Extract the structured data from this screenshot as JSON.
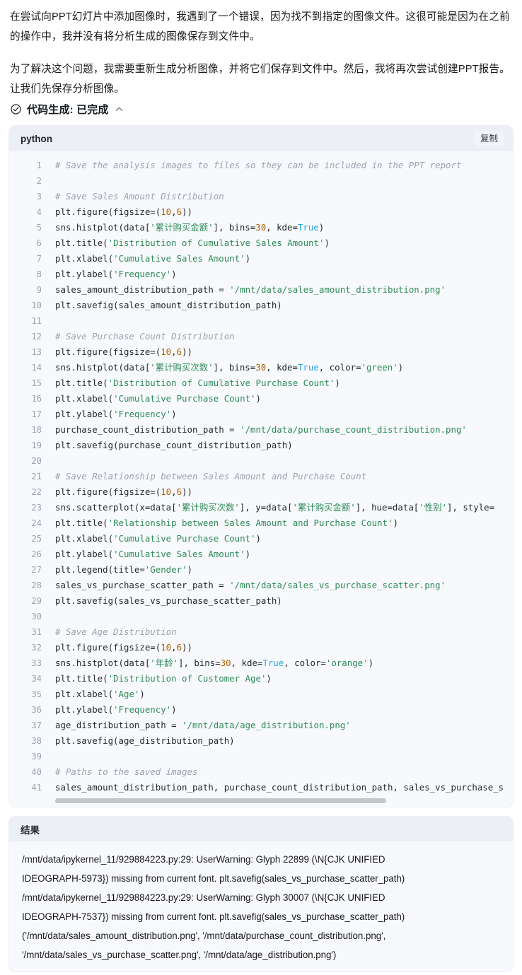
{
  "prose": {
    "paragraph_1": "在尝试向PPT幻灯片中添加图像时，我遇到了一个错误，因为找不到指定的图像文件。这很可能是因为在之前的操作中，我并没有将分析生成的图像保存到文件中。",
    "paragraph_2": "为了解决这个问题，我需要重新生成分析图像，并将它们保存到文件中。然后，我将再次尝试创建PPT报告。让我们先保存分析图像。"
  },
  "status": {
    "label": "代码生成: 已完成",
    "icon": "check-circle-icon",
    "toggle_icon": "chevron-up-icon",
    "accent_color": "#161b22"
  },
  "code_block": {
    "language": "python",
    "copy_label": "复制",
    "header_bg": "#eceff5",
    "body_bg": "#f7f9fc",
    "lines": [
      {
        "n": "1",
        "tokens": [
          {
            "t": "# Save the analysis images to files so they can be included in the PPT report",
            "c": "com"
          }
        ]
      },
      {
        "n": "2",
        "tokens": []
      },
      {
        "n": "3",
        "tokens": [
          {
            "t": "# Save Sales Amount Distribution",
            "c": "com"
          }
        ]
      },
      {
        "n": "4",
        "tokens": [
          {
            "t": "plt.figure(figsize=(",
            "c": "pln"
          },
          {
            "t": "10",
            "c": "num"
          },
          {
            "t": ",",
            "c": "pln"
          },
          {
            "t": "6",
            "c": "num"
          },
          {
            "t": "))",
            "c": "pln"
          }
        ]
      },
      {
        "n": "5",
        "tokens": [
          {
            "t": "sns.histplot(data[",
            "c": "pln"
          },
          {
            "t": "'累计购买金额'",
            "c": "str"
          },
          {
            "t": "], bins=",
            "c": "pln"
          },
          {
            "t": "30",
            "c": "num"
          },
          {
            "t": ", kde=",
            "c": "pln"
          },
          {
            "t": "True",
            "c": "kw"
          },
          {
            "t": ")",
            "c": "pln"
          }
        ]
      },
      {
        "n": "6",
        "tokens": [
          {
            "t": "plt.title(",
            "c": "pln"
          },
          {
            "t": "'Distribution of Cumulative Sales Amount'",
            "c": "str"
          },
          {
            "t": ")",
            "c": "pln"
          }
        ]
      },
      {
        "n": "7",
        "tokens": [
          {
            "t": "plt.xlabel(",
            "c": "pln"
          },
          {
            "t": "'Cumulative Sales Amount'",
            "c": "str"
          },
          {
            "t": ")",
            "c": "pln"
          }
        ]
      },
      {
        "n": "8",
        "tokens": [
          {
            "t": "plt.ylabel(",
            "c": "pln"
          },
          {
            "t": "'Frequency'",
            "c": "str"
          },
          {
            "t": ")",
            "c": "pln"
          }
        ]
      },
      {
        "n": "9",
        "tokens": [
          {
            "t": "sales_amount_distribution_path = ",
            "c": "pln"
          },
          {
            "t": "'/mnt/data/sales_amount_distribution.png'",
            "c": "str"
          }
        ]
      },
      {
        "n": "10",
        "tokens": [
          {
            "t": "plt.savefig(sales_amount_distribution_path)",
            "c": "pln"
          }
        ]
      },
      {
        "n": "11",
        "tokens": []
      },
      {
        "n": "12",
        "tokens": [
          {
            "t": "# Save Purchase Count Distribution",
            "c": "com"
          }
        ]
      },
      {
        "n": "13",
        "tokens": [
          {
            "t": "plt.figure(figsize=(",
            "c": "pln"
          },
          {
            "t": "10",
            "c": "num"
          },
          {
            "t": ",",
            "c": "pln"
          },
          {
            "t": "6",
            "c": "num"
          },
          {
            "t": "))",
            "c": "pln"
          }
        ]
      },
      {
        "n": "14",
        "tokens": [
          {
            "t": "sns.histplot(data[",
            "c": "pln"
          },
          {
            "t": "'累计购买次数'",
            "c": "str"
          },
          {
            "t": "], bins=",
            "c": "pln"
          },
          {
            "t": "30",
            "c": "num"
          },
          {
            "t": ", kde=",
            "c": "pln"
          },
          {
            "t": "True",
            "c": "kw"
          },
          {
            "t": ", color=",
            "c": "pln"
          },
          {
            "t": "'green'",
            "c": "str"
          },
          {
            "t": ")",
            "c": "pln"
          }
        ]
      },
      {
        "n": "15",
        "tokens": [
          {
            "t": "plt.title(",
            "c": "pln"
          },
          {
            "t": "'Distribution of Cumulative Purchase Count'",
            "c": "str"
          },
          {
            "t": ")",
            "c": "pln"
          }
        ]
      },
      {
        "n": "16",
        "tokens": [
          {
            "t": "plt.xlabel(",
            "c": "pln"
          },
          {
            "t": "'Cumulative Purchase Count'",
            "c": "str"
          },
          {
            "t": ")",
            "c": "pln"
          }
        ]
      },
      {
        "n": "17",
        "tokens": [
          {
            "t": "plt.ylabel(",
            "c": "pln"
          },
          {
            "t": "'Frequency'",
            "c": "str"
          },
          {
            "t": ")",
            "c": "pln"
          }
        ]
      },
      {
        "n": "18",
        "tokens": [
          {
            "t": "purchase_count_distribution_path = ",
            "c": "pln"
          },
          {
            "t": "'/mnt/data/purchase_count_distribution.png'",
            "c": "str"
          }
        ]
      },
      {
        "n": "19",
        "tokens": [
          {
            "t": "plt.savefig(purchase_count_distribution_path)",
            "c": "pln"
          }
        ]
      },
      {
        "n": "20",
        "tokens": []
      },
      {
        "n": "21",
        "tokens": [
          {
            "t": "# Save Relationship between Sales Amount and Purchase Count",
            "c": "com"
          }
        ]
      },
      {
        "n": "22",
        "tokens": [
          {
            "t": "plt.figure(figsize=(",
            "c": "pln"
          },
          {
            "t": "10",
            "c": "num"
          },
          {
            "t": ",",
            "c": "pln"
          },
          {
            "t": "6",
            "c": "num"
          },
          {
            "t": "))",
            "c": "pln"
          }
        ]
      },
      {
        "n": "23",
        "tokens": [
          {
            "t": "sns.scatterplot(x=data[",
            "c": "pln"
          },
          {
            "t": "'累计购买次数'",
            "c": "str"
          },
          {
            "t": "], y=data[",
            "c": "pln"
          },
          {
            "t": "'累计购买金额'",
            "c": "str"
          },
          {
            "t": "], hue=data[",
            "c": "pln"
          },
          {
            "t": "'性别'",
            "c": "str"
          },
          {
            "t": "], style=",
            "c": "pln"
          }
        ]
      },
      {
        "n": "24",
        "tokens": [
          {
            "t": "plt.title(",
            "c": "pln"
          },
          {
            "t": "'Relationship between Sales Amount and Purchase Count'",
            "c": "str"
          },
          {
            "t": ")",
            "c": "pln"
          }
        ]
      },
      {
        "n": "25",
        "tokens": [
          {
            "t": "plt.xlabel(",
            "c": "pln"
          },
          {
            "t": "'Cumulative Purchase Count'",
            "c": "str"
          },
          {
            "t": ")",
            "c": "pln"
          }
        ]
      },
      {
        "n": "26",
        "tokens": [
          {
            "t": "plt.ylabel(",
            "c": "pln"
          },
          {
            "t": "'Cumulative Sales Amount'",
            "c": "str"
          },
          {
            "t": ")",
            "c": "pln"
          }
        ]
      },
      {
        "n": "27",
        "tokens": [
          {
            "t": "plt.legend(title=",
            "c": "pln"
          },
          {
            "t": "'Gender'",
            "c": "str"
          },
          {
            "t": ")",
            "c": "pln"
          }
        ]
      },
      {
        "n": "28",
        "tokens": [
          {
            "t": "sales_vs_purchase_scatter_path = ",
            "c": "pln"
          },
          {
            "t": "'/mnt/data/sales_vs_purchase_scatter.png'",
            "c": "str"
          }
        ]
      },
      {
        "n": "29",
        "tokens": [
          {
            "t": "plt.savefig(sales_vs_purchase_scatter_path)",
            "c": "pln"
          }
        ]
      },
      {
        "n": "30",
        "tokens": []
      },
      {
        "n": "31",
        "tokens": [
          {
            "t": "# Save Age Distribution",
            "c": "com"
          }
        ]
      },
      {
        "n": "32",
        "tokens": [
          {
            "t": "plt.figure(figsize=(",
            "c": "pln"
          },
          {
            "t": "10",
            "c": "num"
          },
          {
            "t": ",",
            "c": "pln"
          },
          {
            "t": "6",
            "c": "num"
          },
          {
            "t": "))",
            "c": "pln"
          }
        ]
      },
      {
        "n": "33",
        "tokens": [
          {
            "t": "sns.histplot(data[",
            "c": "pln"
          },
          {
            "t": "'年龄'",
            "c": "str"
          },
          {
            "t": "], bins=",
            "c": "pln"
          },
          {
            "t": "30",
            "c": "num"
          },
          {
            "t": ", kde=",
            "c": "pln"
          },
          {
            "t": "True",
            "c": "kw"
          },
          {
            "t": ", color=",
            "c": "pln"
          },
          {
            "t": "'orange'",
            "c": "str"
          },
          {
            "t": ")",
            "c": "pln"
          }
        ]
      },
      {
        "n": "34",
        "tokens": [
          {
            "t": "plt.title(",
            "c": "pln"
          },
          {
            "t": "'Distribution of Customer Age'",
            "c": "str"
          },
          {
            "t": ")",
            "c": "pln"
          }
        ]
      },
      {
        "n": "35",
        "tokens": [
          {
            "t": "plt.xlabel(",
            "c": "pln"
          },
          {
            "t": "'Age'",
            "c": "str"
          },
          {
            "t": ")",
            "c": "pln"
          }
        ]
      },
      {
        "n": "36",
        "tokens": [
          {
            "t": "plt.ylabel(",
            "c": "pln"
          },
          {
            "t": "'Frequency'",
            "c": "str"
          },
          {
            "t": ")",
            "c": "pln"
          }
        ]
      },
      {
        "n": "37",
        "tokens": [
          {
            "t": "age_distribution_path = ",
            "c": "pln"
          },
          {
            "t": "'/mnt/data/age_distribution.png'",
            "c": "str"
          }
        ]
      },
      {
        "n": "38",
        "tokens": [
          {
            "t": "plt.savefig(age_distribution_path)",
            "c": "pln"
          }
        ]
      },
      {
        "n": "39",
        "tokens": []
      },
      {
        "n": "40",
        "tokens": [
          {
            "t": "# Paths to the saved images",
            "c": "com"
          }
        ]
      },
      {
        "n": "41",
        "tokens": [
          {
            "t": "sales_amount_distribution_path, purchase_count_distribution_path, sales_vs_purchase_s",
            "c": "pln"
          }
        ]
      }
    ]
  },
  "result_block": {
    "title": "结果",
    "lines": [
      "/mnt/data/ipykernel_11/929884223.py:29: UserWarning: Glyph 22899 (\\N{CJK UNIFIED",
      "IDEOGRAPH-5973}) missing from current font. plt.savefig(sales_vs_purchase_scatter_path)",
      "/mnt/data/ipykernel_11/929884223.py:29: UserWarning: Glyph 30007 (\\N{CJK UNIFIED",
      "IDEOGRAPH-7537}) missing from current font. plt.savefig(sales_vs_purchase_scatter_path)",
      "('/mnt/data/sales_amount_distribution.png', '/mnt/data/purchase_count_distribution.png',",
      "'/mnt/data/sales_vs_purchase_scatter.png', '/mnt/data/age_distribution.png')"
    ]
  }
}
